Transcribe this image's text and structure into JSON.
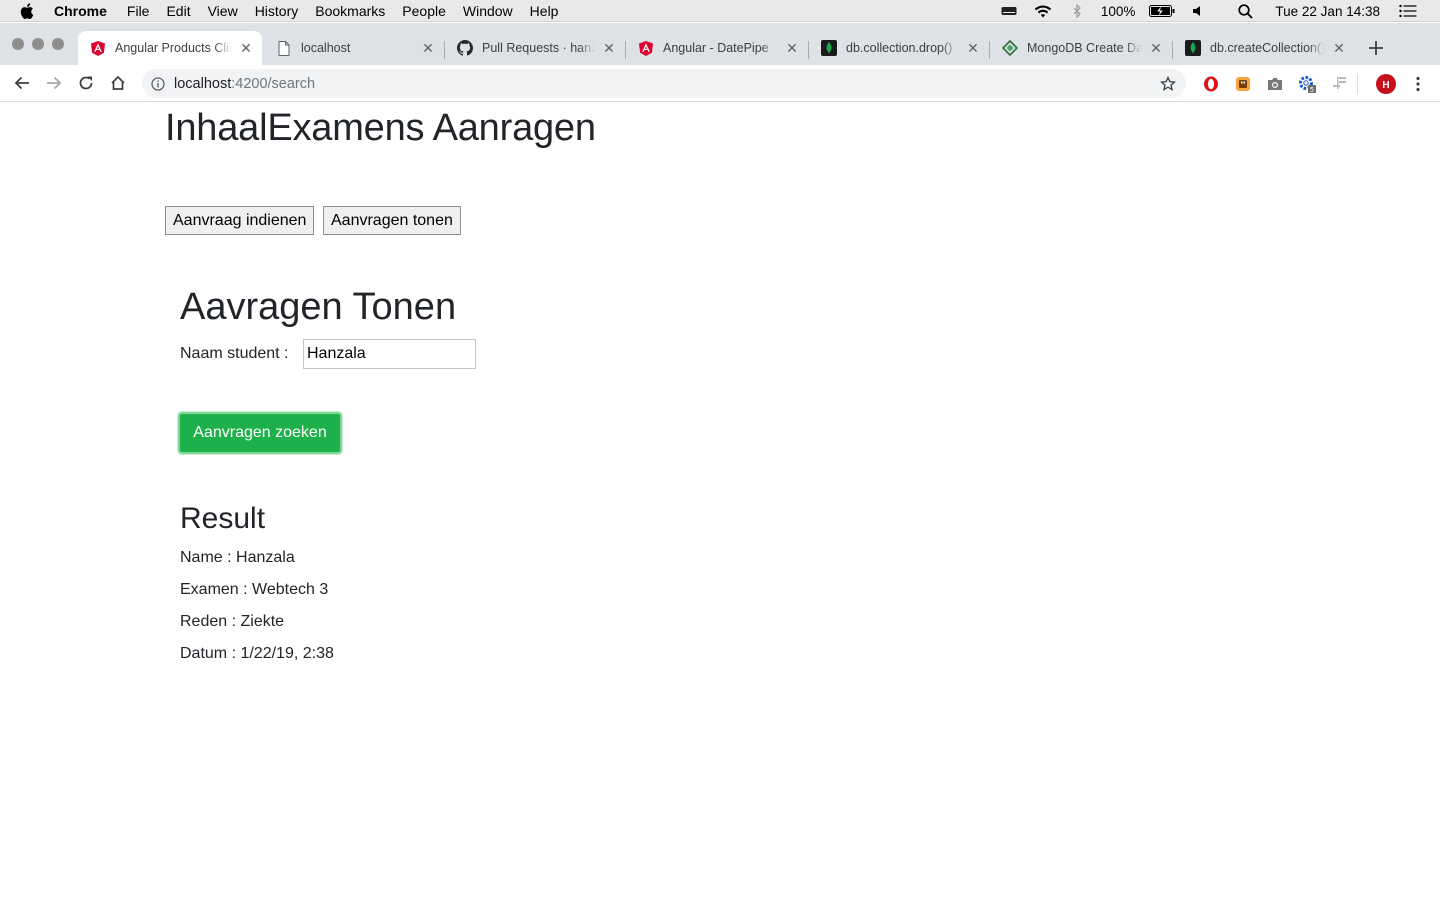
{
  "menubar": {
    "app_name": "Chrome",
    "items": [
      "File",
      "Edit",
      "View",
      "History",
      "Bookmarks",
      "People",
      "Window",
      "Help"
    ],
    "battery": "100%",
    "datetime": "Tue 22 Jan  14:38"
  },
  "tabs": [
    {
      "title": "Angular Products Client",
      "icon": "angular-icon"
    },
    {
      "title": "localhost",
      "icon": "page-icon"
    },
    {
      "title": "Pull Requests · hanzala",
      "icon": "github-icon"
    },
    {
      "title": "Angular - DatePipe",
      "icon": "angular-icon"
    },
    {
      "title": "db.collection.drop()",
      "icon": "mongodb-leaf-icon"
    },
    {
      "title": "MongoDB Create Database",
      "icon": "mongodb-diamond-icon"
    },
    {
      "title": "db.createCollection()",
      "icon": "mongodb-leaf-icon"
    }
  ],
  "address_bar": {
    "host": "localhost",
    "path": ":4200/search"
  },
  "profile_initial": "H",
  "extension_badge": "5",
  "page": {
    "app_title": "InhaalExamens Aanragen",
    "nav_buttons": [
      "Aanvraag indienen",
      "Aanvragen tonen"
    ],
    "section_title": "Aavragen Tonen",
    "student_label": "Naam student :",
    "student_value": "Hanzala",
    "search_button": "Aanvragen zoeken",
    "result_title": "Result",
    "result_lines": [
      "Name : Hanzala",
      "Examen : Webtech 3",
      "Reden : Ziekte",
      "Datum : 1/22/19, 2:38"
    ]
  },
  "colors": {
    "accent_green": "#1eb14b",
    "angular_red": "#dd0031",
    "mongodb_green": "#13aa52"
  }
}
